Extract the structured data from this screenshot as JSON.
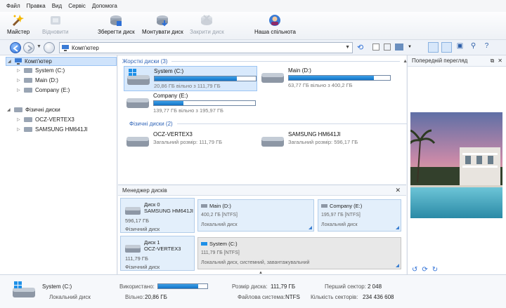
{
  "menu": [
    "Файл",
    "Правка",
    "Вид",
    "Сервіс",
    "Допомога"
  ],
  "toolbar": {
    "wizard": "Майстер",
    "restore": "Відновити",
    "save_disk": "Зберегти диск",
    "mount_disk": "Монтувати диск",
    "close_disk": "Закрити диск",
    "community": "Наша спільнота"
  },
  "address": {
    "value": "Комп'ютер"
  },
  "tree": {
    "root": "Комп'ютер",
    "drives": [
      "System (C:)",
      "Main (D:)",
      "Company (E:)"
    ],
    "physical_root": "Фізичні диски",
    "physical": [
      "OCZ-VERTEX3",
      "SAMSUNG HM641JI"
    ]
  },
  "main": {
    "hard_header": "Жорсткі диски (3)",
    "phys_header": "Фізичні диски (2)",
    "drives": [
      {
        "name": "System (C:)",
        "free": "20,86 ГБ вільно з 111,79 ГБ",
        "used_fraction": 0.81
      },
      {
        "name": "Main (D:)",
        "free": "63,77 ГБ вільно з 400,2 ГБ",
        "used_fraction": 0.84
      },
      {
        "name": "Company (E:)",
        "free": "139,77 ГБ вільно з 195,97 ГБ",
        "used_fraction": 0.29
      }
    ],
    "physical": [
      {
        "name": "OCZ-VERTEX3",
        "size": "Загальний розмір: 111,79 ГБ"
      },
      {
        "name": "SAMSUNG HM641JI",
        "size": "Загальний розмір: 596,17 ГБ"
      }
    ]
  },
  "disk_manager": {
    "title": "Менеджер дисків",
    "disk0": {
      "id": "Диск 0",
      "model": "SAMSUNG HM641JI",
      "size": "596,17 ГБ",
      "type": "Фізичний диск"
    },
    "disk0_parts": [
      {
        "name": "Main (D:)",
        "info": "400,2 ГБ [NTFS]",
        "type": "Локальний диск"
      },
      {
        "name": "Company (E:)",
        "info": "195,97 ГБ [NTFS]",
        "type": "Локальний диск"
      }
    ],
    "disk1": {
      "id": "Диск 1",
      "model": "OCZ-VERTEX3",
      "size": "111,79 ГБ",
      "type": "Фізичний диск"
    },
    "disk1_part": {
      "name": "System (C:)",
      "info": "111,79 ГБ [NTFS]",
      "type": "Локальний диск, системний, завантажувальний"
    }
  },
  "preview": {
    "title": "Попередній перегляд"
  },
  "status": {
    "name": "System (C:)",
    "type": "Локальний диск",
    "used_label": "Використано:",
    "used_fraction": 0.81,
    "free_label": "Вільно:",
    "free": "20,86 ГБ",
    "size_label": "Розмір диска:",
    "size": "111,79 ГБ",
    "fs_label": "Файлова система:",
    "fs": "NTFS",
    "first_label": "Перший сектор:",
    "first": "2 048",
    "count_label": "Кількість секторів:",
    "count": "234 436 608"
  },
  "colors": {
    "accent": "#1a7bd0",
    "header_text": "#3266b8",
    "selection": "#d8e9fc"
  }
}
